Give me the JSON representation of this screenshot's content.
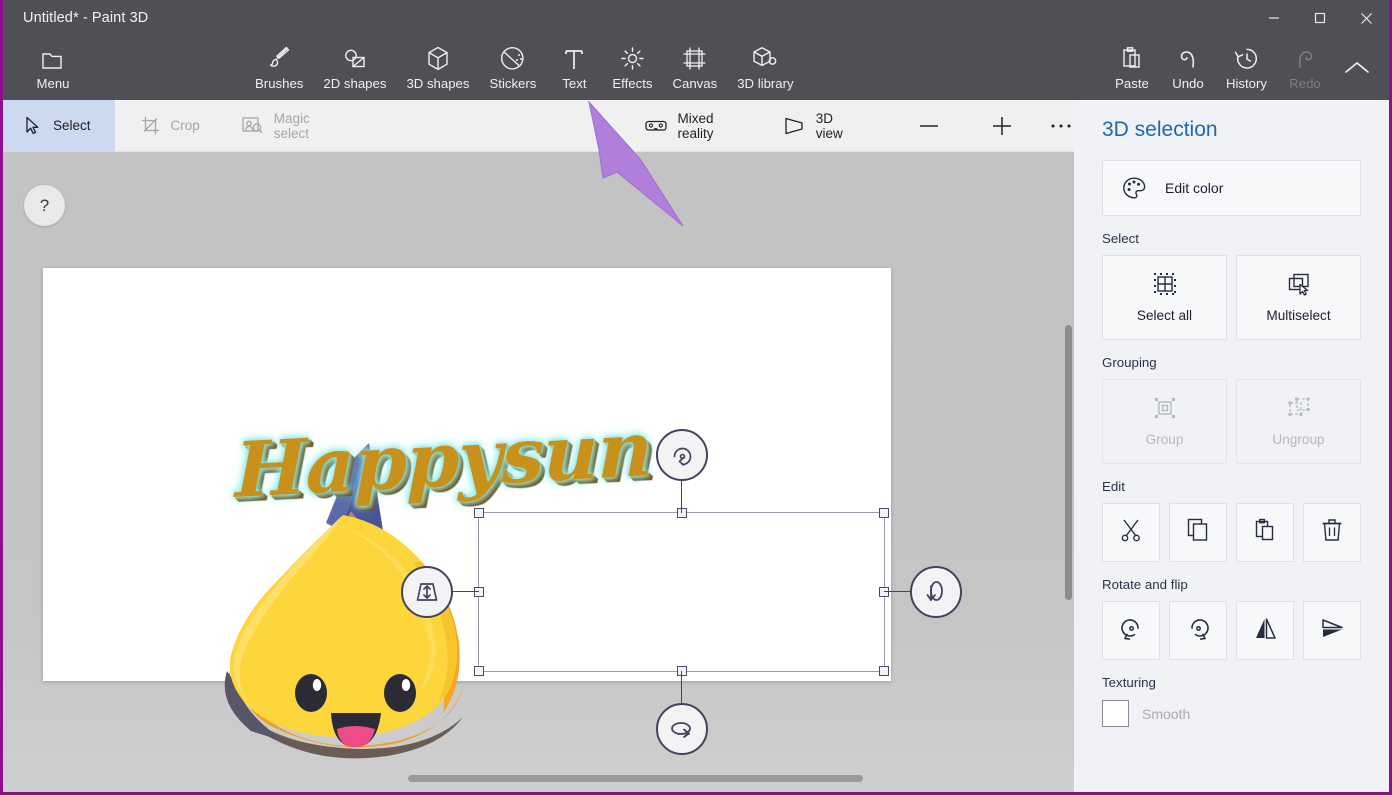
{
  "window": {
    "title": "Untitled* - Paint 3D",
    "minimize_label": "Minimize",
    "maximize_label": "Maximize",
    "close_label": "Close"
  },
  "ribbon": {
    "menu": {
      "label": "Menu",
      "icon": "folder-icon"
    },
    "items": [
      {
        "label": "Brushes",
        "icon": "brush-icon",
        "disabled": false
      },
      {
        "label": "2D shapes",
        "icon": "shapes-2d-icon",
        "disabled": false
      },
      {
        "label": "3D shapes",
        "icon": "cube-icon",
        "disabled": false
      },
      {
        "label": "Stickers",
        "icon": "sticker-icon",
        "disabled": false
      },
      {
        "label": "Text",
        "icon": "text-t-icon",
        "disabled": false
      },
      {
        "label": "Effects",
        "icon": "sun-effects-icon",
        "disabled": false
      },
      {
        "label": "Canvas",
        "icon": "canvas-frame-icon",
        "disabled": false
      },
      {
        "label": "3D library",
        "icon": "cube-search-icon",
        "disabled": false
      }
    ],
    "right_items": [
      {
        "label": "Paste",
        "icon": "clipboard-icon",
        "disabled": false
      },
      {
        "label": "Undo",
        "icon": "undo-arrow-icon",
        "disabled": false
      },
      {
        "label": "History",
        "icon": "clock-history-icon",
        "disabled": false
      },
      {
        "label": "Redo",
        "icon": "redo-arrow-icon",
        "disabled": true
      }
    ],
    "collapse": {
      "label": "Collapse ribbon",
      "icon": "chevron-up-icon"
    }
  },
  "toolbar": {
    "select": {
      "label": "Select",
      "icon": "cursor-arrow-icon",
      "active": true
    },
    "crop": {
      "label": "Crop",
      "icon": "crop-icon",
      "disabled": true
    },
    "magic_select": {
      "label": "Magic select",
      "icon": "magic-select-icon",
      "disabled": true
    },
    "mixed_reality": {
      "label": "Mixed reality",
      "icon": "vr-goggles-icon"
    },
    "view_3d": {
      "label": "3D view",
      "icon": "perspective-icon"
    },
    "zoom_out": {
      "label": "Zoom out",
      "icon": "minus-icon"
    },
    "zoom_in": {
      "label": "Zoom in",
      "icon": "plus-icon"
    },
    "more": {
      "label": "More options",
      "icon": "ellipsis-icon"
    }
  },
  "canvas": {
    "help_label": "?",
    "text_object": "Happysun",
    "sticker_name": "happy-sun-3d-sticker",
    "handles": {
      "rotate_z": "rotate-z-handle",
      "rotate_y": "rotate-y-handle",
      "rotate_x": "rotate-x-handle",
      "depth": "depth-move-handle"
    }
  },
  "panel": {
    "title": "3D selection",
    "edit_color": {
      "label": "Edit color",
      "icon": "palette-icon"
    },
    "select_label": "Select",
    "select_all": {
      "label": "Select all",
      "icon": "select-all-icon"
    },
    "multiselect": {
      "label": "Multiselect",
      "icon": "multiselect-icon"
    },
    "grouping_label": "Grouping",
    "group": {
      "label": "Group",
      "icon": "group-icon",
      "disabled": true
    },
    "ungroup": {
      "label": "Ungroup",
      "icon": "ungroup-icon",
      "disabled": true
    },
    "edit_label": "Edit",
    "edit_buttons": [
      {
        "name": "cut-button",
        "icon": "scissors-icon"
      },
      {
        "name": "copy-button",
        "icon": "copy-icon"
      },
      {
        "name": "paste-button",
        "icon": "clipboard-icon"
      },
      {
        "name": "delete-button",
        "icon": "trash-icon"
      }
    ],
    "rotate_flip_label": "Rotate and flip",
    "rotate_buttons": [
      {
        "name": "rotate-left-button",
        "icon": "rotate-left-icon"
      },
      {
        "name": "rotate-right-button",
        "icon": "rotate-right-icon"
      },
      {
        "name": "flip-horizontal-button",
        "icon": "flip-horizontal-icon"
      },
      {
        "name": "flip-vertical-button",
        "icon": "flip-vertical-icon"
      }
    ],
    "texturing_label": "Texturing",
    "smooth": {
      "label": "Smooth",
      "checked": false
    }
  },
  "colors": {
    "titlebar": "#4f5055",
    "accent_blue": "#1b68b3",
    "select_active": "#ccd9ef",
    "annotation_arrow": "#b07fdc",
    "window_border": "#8e0f8e",
    "text_gold": "#c8911b",
    "text_glow": "#8ff0ee"
  }
}
